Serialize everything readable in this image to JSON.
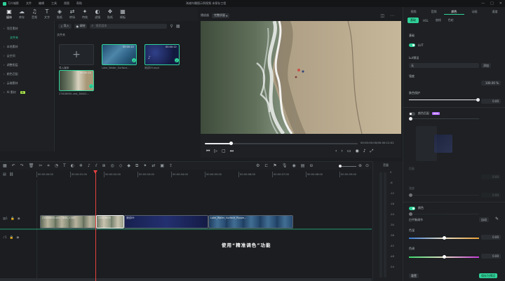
{
  "app": {
    "name": "万兴喵影",
    "title": "海滩鸟瞰图示例视频 未保存工程",
    "menu": [
      "文件",
      "编辑",
      "工具",
      "视图",
      "帮助"
    ]
  },
  "toolbar": {
    "items": [
      {
        "label": "媒体",
        "icon": "folder-icon",
        "glyph": "▣"
      },
      {
        "label": "库存",
        "icon": "stock-icon",
        "glyph": "☁"
      },
      {
        "label": "音频",
        "icon": "music-icon",
        "glyph": "♫"
      },
      {
        "label": "文字",
        "icon": "text-icon",
        "glyph": "T"
      },
      {
        "label": "贴纸",
        "icon": "sticker-icon",
        "glyph": "◈"
      },
      {
        "label": "转场",
        "icon": "transition-icon",
        "glyph": "⇄"
      },
      {
        "label": "特效",
        "icon": "effects-icon",
        "glyph": "✦"
      },
      {
        "label": "滤镜",
        "icon": "filter-icon",
        "glyph": "◐"
      },
      {
        "label": "贴纸",
        "icon": "element-icon",
        "glyph": "❖"
      },
      {
        "label": "模板",
        "icon": "template-icon",
        "glyph": "▦"
      }
    ]
  },
  "sidebar": {
    "items": [
      {
        "label": "项目素材",
        "active": false,
        "sub": false
      },
      {
        "label": "文件夹",
        "active": true,
        "sub": true
      },
      {
        "label": "本地素材",
        "active": false,
        "sub": false
      },
      {
        "label": "云空间",
        "active": false,
        "sub": false
      },
      {
        "label": "调整图层",
        "active": false,
        "sub": false
      },
      {
        "label": "颜色匹配",
        "active": false,
        "sub": false
      },
      {
        "label": "云端素材",
        "active": false,
        "sub": false
      },
      {
        "label": "AI 素材",
        "active": false,
        "sub": false,
        "badge": "新"
      }
    ]
  },
  "media": {
    "import_label": "导入",
    "record_label": "录制",
    "search_placeholder": "搜索媒体",
    "folder_label": "文件夹",
    "items": [
      {
        "caption": "导入媒体",
        "type": "import"
      },
      {
        "caption": "Lake_Water_Surface...",
        "duration": "00:00:10",
        "type": "water"
      },
      {
        "caption": "测试09.mp4",
        "duration": "00:00:12",
        "type": "dark"
      },
      {
        "caption": "27816655-uhd_38402...",
        "duration": "00:00:15",
        "type": "beach"
      }
    ]
  },
  "preview": {
    "quality_label": "播放器",
    "resolution_label": "完整质量",
    "current_time": "00:00:00:00",
    "total_time": "00:00:12:02",
    "progress": 0.17
  },
  "right": {
    "tabs": [
      "视频",
      "音频",
      "颜色",
      "动画",
      "速度"
    ],
    "active_tab": 2,
    "subtabs": [
      "基础",
      "HSL",
      "曲线",
      "色轮"
    ],
    "active_subtab": 0,
    "section_basic": "基础",
    "lut_label": "LUT",
    "lut_preset_label": "Lut预设",
    "lut_preset_value": "无",
    "lut_button": "添加",
    "strength_label": "强度",
    "strength_value": "100.00",
    "strength_unit": "%",
    "protect_label": "肤色保护",
    "protect_value": "0.00",
    "ai_match_label": "颜色匹配",
    "ai_badge": "NEW",
    "match_label": "匹配",
    "match_value": "0.00",
    "match_label2": "强度",
    "match_value2": "0.00",
    "color_label": "颜色",
    "white_balance_label": "白平衡调节",
    "wb_button": "自动",
    "temp_label": "色温",
    "temp_value": "0.00",
    "tint_label": "色调",
    "tint_value": "0.00",
    "reset_label": "重置",
    "save_label": "保存为预设",
    "ok_label": "确定"
  },
  "timeline": {
    "ruler": [
      "00:00:00:00",
      "00:00:01:00",
      "00:00:02:00",
      "00:00:03:00",
      "00:00:04:00",
      "00:00:05:00",
      "00:00:06:00",
      "00:00:07:00",
      "00:00:08:00",
      "00:00:09:00"
    ],
    "clips": [
      {
        "label": "27816655-uhd_3840_2160",
        "type": "beach"
      },
      {
        "label": "27816655",
        "type": "beach"
      },
      {
        "label": "测试09",
        "type": "dark"
      },
      {
        "label": "Lake_Water_Surface_Ripple...",
        "type": "water"
      }
    ],
    "caption": "使用“精准调色”功能",
    "meter_label": "音量",
    "meter_ticks": [
      "0",
      "-6",
      "-12",
      "-18",
      "-24",
      "-30",
      "-36",
      "-42",
      "-48",
      "-54"
    ]
  },
  "colors": {
    "accent": "#2fd39a",
    "playhead": "#e8423f",
    "panel": "#1e2023"
  }
}
